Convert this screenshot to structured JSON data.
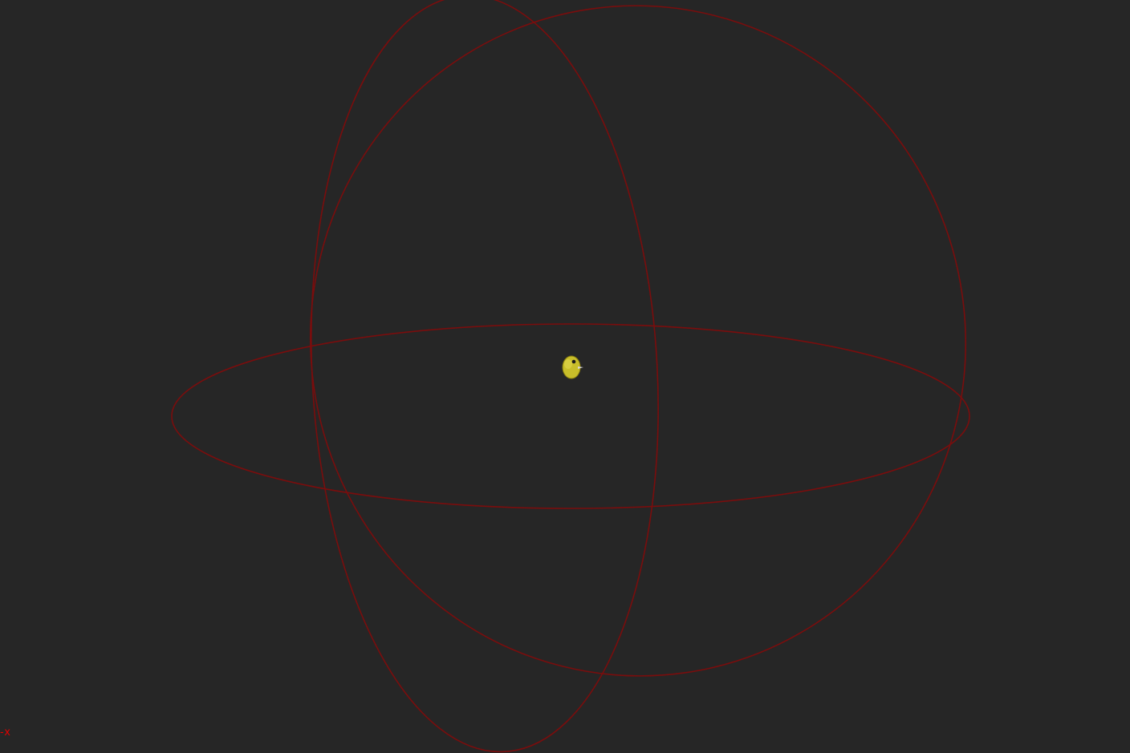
{
  "viewport": {
    "background_color": "#262626",
    "gizmo_color": "#7a0d0d",
    "object_color": "#c8be2a",
    "axis_label": "-x",
    "axis_label_color": "#e00000"
  }
}
